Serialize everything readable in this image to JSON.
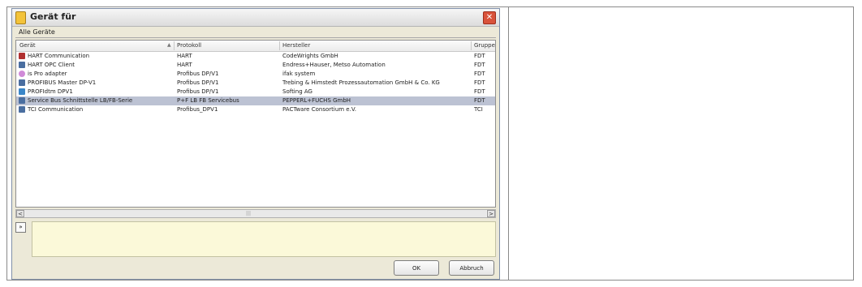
{
  "window": {
    "title": "Gerät für"
  },
  "subtitle": "Alle Geräte",
  "table": {
    "columns": [
      "Gerät",
      "Protokoll",
      "Hersteller",
      "Gruppe"
    ],
    "sort_indicator": "▲",
    "rows": [
      {
        "icon": "hart-communication-icon",
        "device": "HART Communication",
        "protocol": "HART",
        "vendor": "CodeWrights GmbH",
        "group": "FDT"
      },
      {
        "icon": "device-plug-icon",
        "device": "HART OPC Client",
        "protocol": "HART",
        "vendor": "Endress+Hauser, Metso Automation",
        "group": "FDT"
      },
      {
        "icon": "globe-adapter-icon",
        "device": "is Pro adapter",
        "protocol": "Profibus DP/V1",
        "vendor": "ifak system",
        "group": "FDT"
      },
      {
        "icon": "device-plug-icon",
        "device": "PROFIBUS Master DP-V1",
        "protocol": "Profibus DP/V1",
        "vendor": "Trebing & Himstedt Prozessautomation GmbH & Co. KG",
        "group": "FDT"
      },
      {
        "icon": "profidtm-icon",
        "device": "PROFIdtm DPV1",
        "protocol": "Profibus DP/V1",
        "vendor": "Softing AG",
        "group": "FDT"
      },
      {
        "icon": "device-plug-icon",
        "device": "Service Bus Schnittstelle LB/FB-Serie",
        "protocol": "P+F LB FB Servicebus",
        "vendor": "PEPPERL+FUCHS GmbH",
        "group": "FDT"
      },
      {
        "icon": "device-plug-icon",
        "device": "TCI Communication",
        "protocol": "Profibus_DPV1",
        "vendor": "PACTware Consortium e.V.",
        "group": "TCI"
      }
    ],
    "selected_index": 5
  },
  "scrollbar": {
    "left_arrow": "<",
    "right_arrow": ">",
    "grip": "|||"
  },
  "expander_glyph": "»",
  "buttons": {
    "ok": "OK",
    "cancel": "Abbruch"
  },
  "colors": {
    "selection": "#bcc2d3",
    "info_pane": "#fbf9d9",
    "close": "#d9533b"
  }
}
